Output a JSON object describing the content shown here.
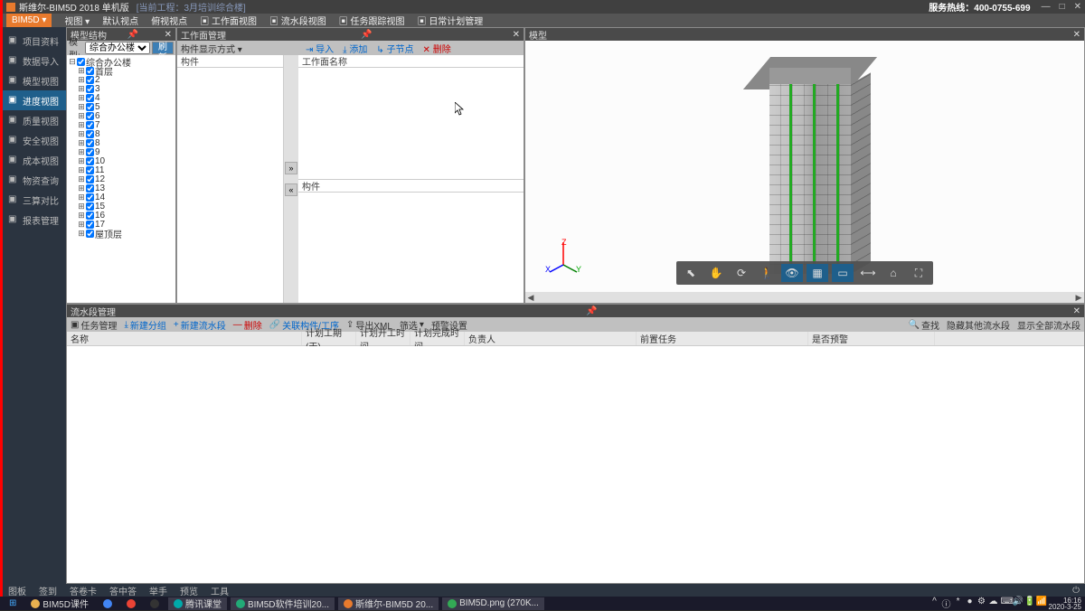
{
  "titlebar": {
    "app": "斯维尔-BIM5D 2018 单机版",
    "project": "[当前工程：3月培训综合楼]",
    "hotline": "服务热线：400-0755-699"
  },
  "menubar": {
    "brand": "BIM5D",
    "items": [
      "视图",
      "默认视点",
      "俯视视点",
      "工作面视图",
      "流水段视图",
      "任务跟踪视图",
      "日常计划管理"
    ]
  },
  "sidebar": {
    "items": [
      {
        "label": "项目资料",
        "ico": "file-icon"
      },
      {
        "label": "数据导入",
        "ico": "import-icon"
      },
      {
        "label": "模型视图",
        "ico": "model-icon"
      },
      {
        "label": "进度视图",
        "ico": "progress-icon",
        "active": true
      },
      {
        "label": "质量视图",
        "ico": "quality-icon"
      },
      {
        "label": "安全视图",
        "ico": "safety-icon"
      },
      {
        "label": "成本视图",
        "ico": "cost-icon"
      },
      {
        "label": "物资查询",
        "ico": "material-icon"
      },
      {
        "label": "三算对比",
        "ico": "compare-icon"
      },
      {
        "label": "报表管理",
        "ico": "report-icon"
      }
    ]
  },
  "panels": {
    "struct": {
      "title": "模型结构",
      "model_label": "模型:",
      "model_sel": "综合办公楼",
      "refresh": "刷新",
      "tree_root": "综合办公楼",
      "tree_items": [
        "首层",
        "2",
        "3",
        "4",
        "5",
        "6",
        "7",
        "8",
        "8",
        "9",
        "10",
        "11",
        "12",
        "13",
        "14",
        "15",
        "16",
        "17",
        "屋顶层"
      ]
    },
    "work": {
      "title": "工作面管理",
      "display_label": "构件显示方式",
      "left_header": "构件",
      "right_top_header": "工作面名称",
      "right_bottom_header": "构件",
      "toolbar": {
        "import": "导入",
        "add": "添加",
        "child": "子节点",
        "delete": "删除"
      }
    },
    "model": {
      "title": "模型",
      "tools": [
        "pointer",
        "pan",
        "orbit",
        "walk",
        "visibility",
        "section",
        "edges",
        "ruler",
        "home",
        "fullscreen"
      ]
    },
    "flow": {
      "title": "流水段管理",
      "toolbar": {
        "task": "任务管理",
        "newgroup": "新建分组",
        "newflow": "新建流水段",
        "delete": "删除",
        "link": "关联构件/工序",
        "export": "导出XML",
        "filter": "筛选",
        "warn": "预警设置",
        "find": "查找",
        "hide": "隐藏其他流水段",
        "showall": "显示全部流水段"
      },
      "headers": [
        "名称",
        "计划工期(天)",
        "计划开工时间",
        "计划完成时间",
        "负责人",
        "前置任务",
        "是否预警"
      ]
    }
  },
  "statusbar": {
    "items": [
      "图板",
      "签到",
      "答卷卡",
      "答中答",
      "举手",
      "预览",
      "工具"
    ]
  },
  "taskbar": {
    "items": [
      {
        "label": "BIM5D课件",
        "ico": "folder-icon",
        "color": "#e8b050"
      },
      {
        "label": "",
        "ico": "chrome-icon",
        "color": "#4285f4"
      },
      {
        "label": "",
        "ico": "chrome-icon",
        "color": "#ea4335"
      },
      {
        "label": "",
        "ico": "app-icon",
        "color": "#333"
      },
      {
        "label": "腾讯课堂",
        "ico": "edu-icon",
        "color": "#0aa"
      },
      {
        "label": "BIM5D软件培训20...",
        "ico": "app-icon",
        "color": "#2a7"
      },
      {
        "label": "斯维尔-BIM5D 20...",
        "ico": "app-icon",
        "color": "#e87a2d"
      },
      {
        "label": "BIM5D.png (270K...",
        "ico": "img-icon",
        "color": "#3a5"
      }
    ],
    "clock_time": "16:16",
    "clock_date": "2020-3-25"
  }
}
